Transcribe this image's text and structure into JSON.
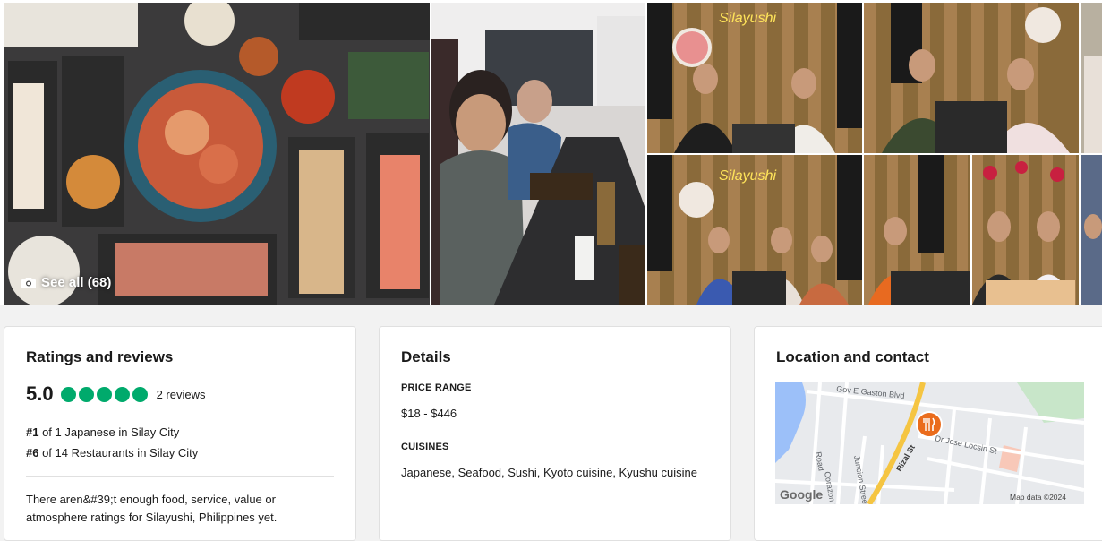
{
  "gallery": {
    "see_all_label": "See all (68)",
    "sign_text": "Silayushi"
  },
  "ratings": {
    "title": "Ratings and reviews",
    "score": "5.0",
    "bubbles_filled": 5,
    "reviews_label": "2 reviews",
    "rank1_prefix": "#1",
    "rank1_text": " of 1 Japanese in Silay City",
    "rank2_prefix": "#6",
    "rank2_text": " of 14 Restaurants in Silay City",
    "note": "There aren&#39;t enough food, service, value or atmosphere ratings for Silayushi, Philippines yet."
  },
  "details": {
    "title": "Details",
    "price_label": "PRICE RANGE",
    "price_value": "$18 - $446",
    "cuisines_label": "CUISINES",
    "cuisines_value": "Japanese, Seafood, Sushi, Kyoto cuisine, Kyushu cuisine"
  },
  "location": {
    "title": "Location and contact",
    "map": {
      "streets": [
        "Gov E Gaston Blvd",
        "Rizal St",
        "Dr Jose Locsin St",
        "Road",
        "Juncion Street",
        "Corazon St"
      ],
      "google_logo": "Google",
      "attribution": "Map data ©2024"
    }
  },
  "colors": {
    "bubble": "#00aa6c",
    "pin": "#ea6c1c",
    "highway": "#f5c542"
  }
}
